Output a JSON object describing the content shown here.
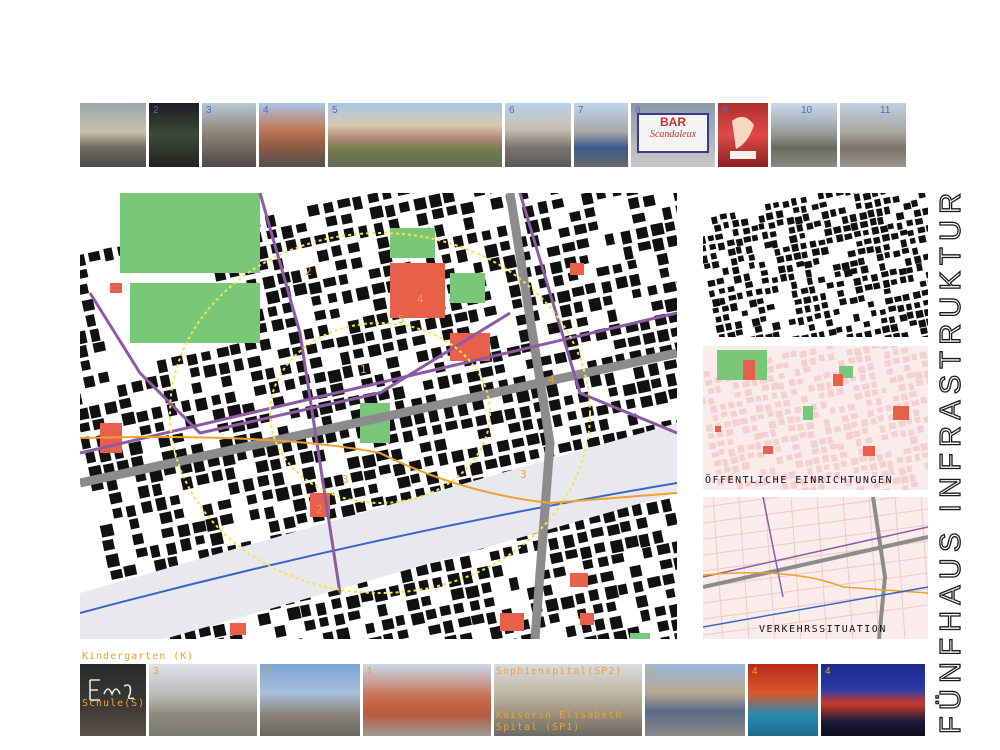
{
  "title": "FÜNFHAUS INFRASTRUKTUR",
  "top_photos": [
    {
      "num": "",
      "num_color": "blue"
    },
    {
      "num": "2",
      "num_color": "blue"
    },
    {
      "num": "3",
      "num_color": "blue"
    },
    {
      "num": "4",
      "num_color": "blue"
    },
    {
      "num": "5",
      "num_color": "blue"
    },
    {
      "num": "6",
      "num_color": "blue"
    },
    {
      "num": "7",
      "num_color": "blue"
    },
    {
      "num": "8",
      "num_color": "blue"
    },
    {
      "num": "9",
      "num_color": "blue"
    },
    {
      "num": "10",
      "num_color": "blue"
    },
    {
      "num": "11",
      "num_color": "blue"
    }
  ],
  "bar_sign": {
    "line1": "BAR",
    "line2": "Scandaleux"
  },
  "map_labels": [
    "2",
    "4",
    "5",
    "3",
    "2",
    "1",
    "3",
    "4"
  ],
  "side_panels": {
    "panel2_caption": "ÖFFENTLICHE EINRICHTUNGEN",
    "panel3_caption": "VERKEHRSSITUATION"
  },
  "bottom": {
    "kindergarten": "Kindergarten (K)",
    "schule": "Schule(S)",
    "sophienspital": "Sophienspital(SP2)",
    "kaiserin_line1": "Kaiserin Elisabeth",
    "kaiserin_line2": "Spital (SP1)",
    "photo_nums": [
      "",
      "3",
      "2",
      "1",
      "",
      "5",
      "4",
      "4"
    ]
  },
  "colors": {
    "green": "#78c878",
    "red": "#e8604a",
    "purple": "#8e5aa8",
    "orange": "#f0a030",
    "yellow": "#f2e64a",
    "blue": "#3a64c8",
    "grey": "#8c8c8c"
  }
}
